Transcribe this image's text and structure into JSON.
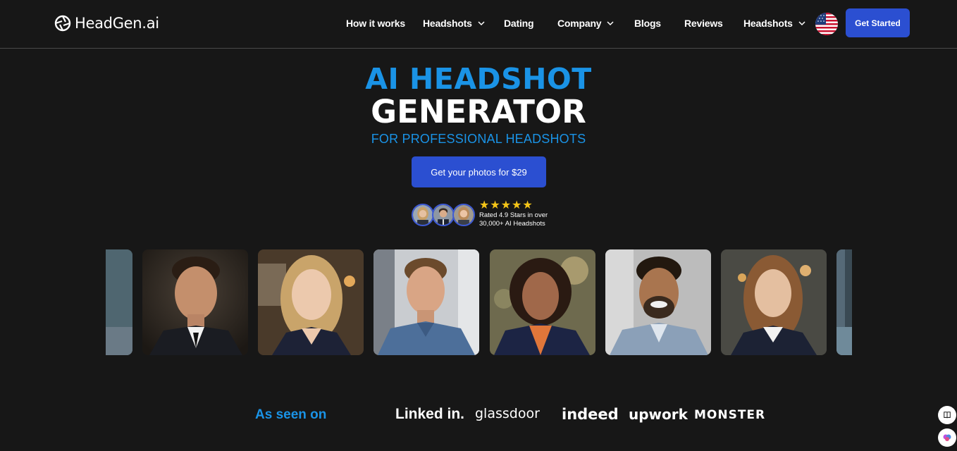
{
  "brand": {
    "name": "HeadGen.ai"
  },
  "nav": {
    "items": [
      {
        "label": "How it works",
        "has_dropdown": false
      },
      {
        "label": "Headshots",
        "has_dropdown": true
      },
      {
        "label": "Dating",
        "has_dropdown": false
      },
      {
        "label": "Company",
        "has_dropdown": true
      },
      {
        "label": "Blogs",
        "has_dropdown": false
      },
      {
        "label": "Reviews",
        "has_dropdown": false
      },
      {
        "label": "Headshots",
        "has_dropdown": true
      }
    ],
    "language_flag": "us-flag-icon",
    "cta_label": "Get Started"
  },
  "hero": {
    "line1": "AI HEADSHOT",
    "line2": "GENERATOR",
    "subtitle": "FOR PROFESSIONAL HEADSHOTS",
    "cta_label": "Get your photos for $29",
    "rating": {
      "stars": "★★★★★",
      "line1": "Rated 4.9 Stars in over",
      "line2": "30,000+ AI Headshots"
    }
  },
  "gallery": {
    "photos": [
      "partial-headshot-left",
      "man-dark-suit-headshot",
      "blonde-woman-headshot",
      "man-denim-shirt-headshot",
      "woman-curly-hair-blazer-headshot",
      "bearded-man-blazer-headshot",
      "woman-long-hair-headshot",
      "partial-headshot-right"
    ]
  },
  "as_seen_on": {
    "label": "As seen on",
    "brands": [
      "Linked in.",
      "glassdoor",
      "indeed",
      "upwork",
      "MONSTER"
    ]
  },
  "colors": {
    "accent_blue": "#1a93e6",
    "button_blue": "#2b4fd1",
    "background": "#171717",
    "star_yellow": "#f5c518"
  }
}
